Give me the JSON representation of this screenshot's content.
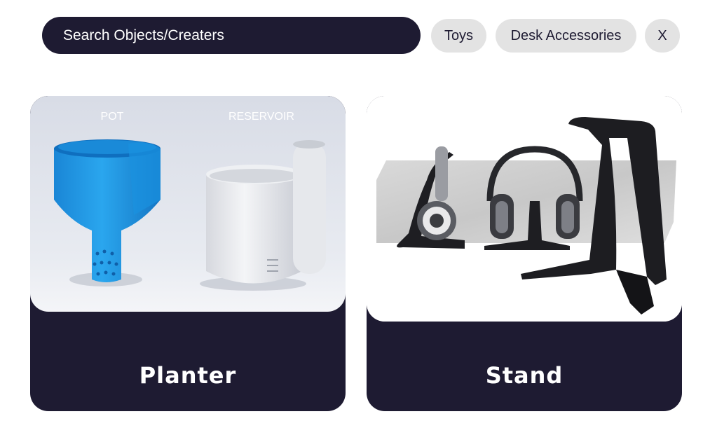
{
  "search": {
    "placeholder": "Search Objects/Creaters"
  },
  "filters": {
    "chips": [
      "Toys",
      "Desk Accessories"
    ],
    "clear_label": "X"
  },
  "cards": [
    {
      "title": "Planter",
      "image_labels": [
        "POT",
        "RESERVOIR"
      ]
    },
    {
      "title": "Stand"
    }
  ],
  "colors": {
    "dark": "#1e1b32",
    "chip_bg": "#e3e3e3",
    "pot_blue": "#1e9be0"
  }
}
